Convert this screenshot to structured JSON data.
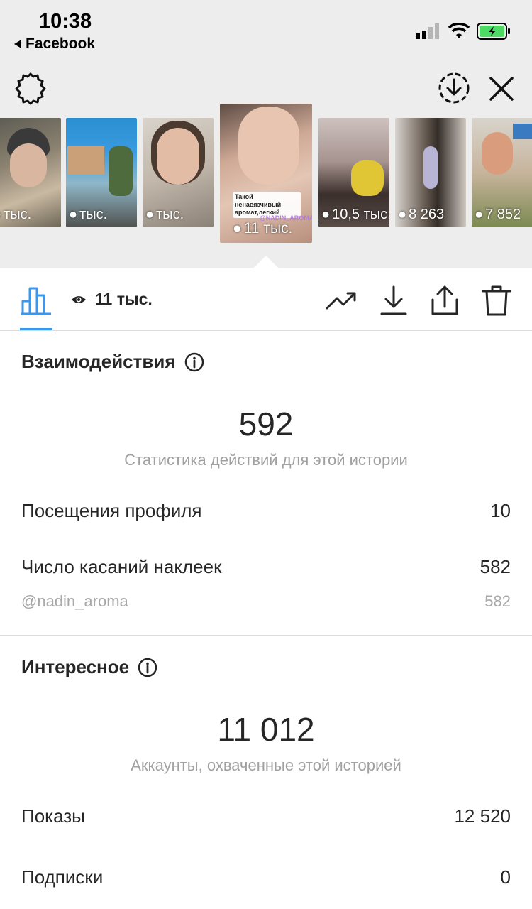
{
  "status_bar": {
    "time": "10:38",
    "back_app": "Facebook",
    "icons": [
      "signal-icon",
      "wifi-icon",
      "battery-charging-icon"
    ]
  },
  "header": {
    "icons": [
      "settings-gear-icon",
      "download-circle-icon",
      "close-icon"
    ]
  },
  "stories": [
    {
      "views": "тыс."
    },
    {
      "views": "тыс."
    },
    {
      "views": "тыс."
    },
    {
      "views": "11 тыс.",
      "caption": "Такой ненавязчивый аромат,легкий",
      "tag": "@NADIN_AROMA",
      "selected": true
    },
    {
      "views": "10,5 тыс."
    },
    {
      "views": "8 263"
    },
    {
      "views": "7 852"
    }
  ],
  "toolbar": {
    "views": "11 тыс.",
    "icons": [
      "bar-chart-icon",
      "eye-icon",
      "trending-icon",
      "download-icon",
      "share-icon",
      "trash-icon"
    ]
  },
  "interactions": {
    "title": "Взаимодействия",
    "total": "592",
    "subtitle": "Статистика действий для этой истории",
    "rows": [
      {
        "label": "Посещения профиля",
        "value": "10"
      },
      {
        "label": "Число касаний наклеек",
        "value": "582"
      },
      {
        "label": "@nadin_aroma",
        "value": "582"
      }
    ]
  },
  "discovery": {
    "title": "Интересное",
    "total": "11 012",
    "subtitle": "Аккаунты, охваченные этой историей",
    "rows": [
      {
        "label": "Показы",
        "value": "12 520"
      },
      {
        "label": "Подписки",
        "value": "0"
      }
    ]
  },
  "colors": {
    "accent": "#3897f0",
    "battery": "#4cd964",
    "muted_text": "#a0a0a0"
  }
}
